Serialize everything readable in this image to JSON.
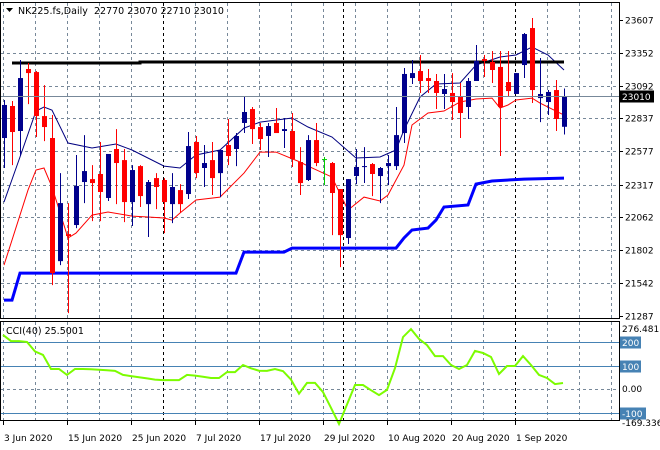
{
  "header": {
    "symbol": "NK225.fs,Daily",
    "ohlc": "22770 23070 22710 23010",
    "menu_icon": "triangle-down-icon"
  },
  "price_axis": {
    "ticks": [
      "23607",
      "23352",
      "23092",
      "22837",
      "22577",
      "22317",
      "22062",
      "21802",
      "21542",
      "21287"
    ],
    "current_price_label": "23010"
  },
  "cci_panel": {
    "title": "CCI(40) 25.5001",
    "max_label": "276.4817",
    "min_label": "-169.336",
    "level_labels": [
      "200",
      "100",
      "-100"
    ],
    "zero_label": "0.00"
  },
  "time_axis": {
    "labels": [
      "3 Jun 2020",
      "15 Jun 2020",
      "25 Jun 2020",
      "7 Jul 2020",
      "17 Jul 2020",
      "29 Jul 2020",
      "10 Aug 2020",
      "20 Aug 2020",
      "1 Sep 2020"
    ]
  },
  "colors": {
    "bull": "#00008c",
    "bear": "#ff0000",
    "doji": "#00d000",
    "ma_fast": "#000080",
    "ma_slow": "#ff0000",
    "support": "#0000ff",
    "resistance": "#000000",
    "cci": "#7cfc00",
    "cci_levels": "#4682b4",
    "grid": "#778899"
  },
  "chart_data": {
    "type": "candlestick",
    "title": "NK225.fs,Daily",
    "ylim": [
      21287,
      23607
    ],
    "current_price": 23010,
    "month_separators": [
      20,
      42.5,
      64
    ],
    "ohlc": [
      [
        22682,
        22980,
        22447,
        22941
      ],
      [
        22933,
        22972,
        22470,
        22729
      ],
      [
        22737,
        23293,
        22541,
        23152
      ],
      [
        23223,
        23270,
        22948,
        23191
      ],
      [
        23199,
        23207,
        22690,
        22854
      ],
      [
        22854,
        23097,
        22658,
        22768
      ],
      [
        22682,
        22862,
        21529,
        21623
      ],
      [
        21717,
        22407,
        21686,
        22172
      ],
      [
        21929,
        22172,
        21310,
        21914
      ],
      [
        22000,
        22549,
        21976,
        22306
      ],
      [
        22337,
        22705,
        22172,
        22423
      ],
      [
        22360,
        22470,
        22031,
        22329
      ],
      [
        22400,
        22651,
        22031,
        22259
      ],
      [
        22212,
        22557,
        22188,
        22557
      ],
      [
        22596,
        22752,
        22164,
        22486
      ],
      [
        22509,
        22596,
        22023,
        22180
      ],
      [
        22180,
        22470,
        21992,
        22431
      ],
      [
        22462,
        22470,
        22141,
        22227
      ],
      [
        22164,
        22353,
        21906,
        22337
      ],
      [
        22368,
        22407,
        22125,
        22298
      ],
      [
        22353,
        22368,
        21937,
        22180
      ],
      [
        22164,
        22407,
        22015,
        22298
      ],
      [
        22274,
        22321,
        22094,
        22164
      ],
      [
        22243,
        22729,
        22204,
        22619
      ],
      [
        22651,
        22698,
        22368,
        22408
      ],
      [
        22447,
        22627,
        22298,
        22486
      ],
      [
        22509,
        22651,
        22235,
        22368
      ],
      [
        22407,
        22588,
        22219,
        22588
      ],
      [
        22627,
        22831,
        22470,
        22541
      ],
      [
        22596,
        22721,
        22462,
        22698
      ],
      [
        22800,
        23003,
        22721,
        22886
      ],
      [
        22909,
        22925,
        22635,
        22752
      ],
      [
        22768,
        22800,
        22588,
        22674
      ],
      [
        22698,
        22800,
        22533,
        22776
      ],
      [
        22800,
        22917,
        22721,
        22721
      ],
      [
        22737,
        22839,
        22604,
        22752
      ],
      [
        22737,
        22878,
        22455,
        22517
      ],
      [
        22494,
        22611,
        22235,
        22329
      ],
      [
        22353,
        22705,
        22345,
        22666
      ],
      [
        22666,
        22800,
        22462,
        22486
      ],
      [
        22517,
        22533,
        22313,
        22517
      ],
      [
        22486,
        22494,
        21921,
        22251
      ],
      [
        22282,
        22282,
        21670,
        21921
      ],
      [
        21898,
        22360,
        21851,
        22360
      ],
      [
        22384,
        22596,
        22321,
        22455
      ],
      [
        22455,
        22611,
        22329,
        22462
      ],
      [
        22478,
        22486,
        22227,
        22400
      ],
      [
        22384,
        22455,
        22172,
        22447
      ],
      [
        22462,
        22549,
        22313,
        22486
      ],
      [
        22462,
        22925,
        22431,
        22705
      ],
      [
        22721,
        23231,
        22643,
        23184
      ],
      [
        23152,
        23293,
        23105,
        23191
      ],
      [
        23207,
        23333,
        23035,
        23129
      ],
      [
        23152,
        23223,
        23035,
        23129
      ],
      [
        23129,
        23184,
        22909,
        23035
      ],
      [
        23027,
        23184,
        22909,
        23066
      ],
      [
        23035,
        23191,
        22823,
        22964
      ],
      [
        23011,
        23113,
        22682,
        22878
      ],
      [
        22925,
        23152,
        22831,
        23129
      ],
      [
        23129,
        23411,
        23129,
        23286
      ],
      [
        23301,
        23333,
        23160,
        23286
      ],
      [
        23278,
        23364,
        23113,
        23215
      ],
      [
        23239,
        23364,
        22541,
        22925
      ],
      [
        23121,
        23364,
        23003,
        23050
      ],
      [
        23027,
        23191,
        23027,
        23191
      ],
      [
        23254,
        23505,
        23152,
        23497
      ],
      [
        23544,
        23623,
        22956,
        23058
      ],
      [
        22995,
        23309,
        22807,
        23027
      ],
      [
        22964,
        23058,
        22862,
        23043
      ],
      [
        23058,
        23137,
        22737,
        22831
      ],
      [
        22770,
        23070,
        22710,
        23010
      ]
    ],
    "ma_fast": [
      [
        0,
        22180
      ],
      [
        2,
        22533
      ],
      [
        4,
        22894
      ],
      [
        5,
        22925
      ],
      [
        6,
        22901
      ],
      [
        8,
        22643
      ],
      [
        11,
        22604
      ],
      [
        14,
        22635
      ],
      [
        16,
        22588
      ],
      [
        20,
        22462
      ],
      [
        22,
        22447
      ],
      [
        24,
        22549
      ],
      [
        27,
        22588
      ],
      [
        30,
        22760
      ],
      [
        32,
        22807
      ],
      [
        36,
        22839
      ],
      [
        38,
        22768
      ],
      [
        41,
        22690
      ],
      [
        44,
        22525
      ],
      [
        47,
        22533
      ],
      [
        49,
        22588
      ],
      [
        50,
        22745
      ],
      [
        52,
        23003
      ],
      [
        54,
        23105
      ],
      [
        57,
        23113
      ],
      [
        59,
        23254
      ],
      [
        62,
        23317
      ],
      [
        64,
        23333
      ],
      [
        66,
        23395
      ],
      [
        68,
        23333
      ],
      [
        70,
        23215
      ]
    ],
    "ma_slow": [
      [
        0,
        21686
      ],
      [
        3,
        22274
      ],
      [
        4,
        22431
      ],
      [
        5,
        22447
      ],
      [
        6,
        22298
      ],
      [
        8,
        21898
      ],
      [
        9,
        21937
      ],
      [
        11,
        22078
      ],
      [
        13,
        22102
      ],
      [
        16,
        22070
      ],
      [
        18,
        22063
      ],
      [
        20,
        22055
      ],
      [
        21,
        22039
      ],
      [
        22,
        22094
      ],
      [
        24,
        22196
      ],
      [
        27,
        22219
      ],
      [
        30,
        22407
      ],
      [
        32,
        22572
      ],
      [
        34,
        22572
      ],
      [
        37,
        22494
      ],
      [
        38,
        22462
      ],
      [
        41,
        22376
      ],
      [
        43,
        22117
      ],
      [
        45,
        22219
      ],
      [
        47,
        22188
      ],
      [
        48,
        22235
      ],
      [
        50,
        22470
      ],
      [
        51,
        22784
      ],
      [
        53,
        22878
      ],
      [
        55,
        22894
      ],
      [
        57,
        22964
      ],
      [
        59,
        22988
      ],
      [
        61,
        22995
      ],
      [
        62,
        22917
      ],
      [
        63,
        22941
      ],
      [
        64,
        22980
      ],
      [
        66,
        22995
      ],
      [
        67,
        22956
      ],
      [
        70,
        22862
      ]
    ],
    "support_line": [
      [
        0,
        21412
      ],
      [
        1,
        21412
      ],
      [
        2,
        21623
      ],
      [
        29,
        21623
      ],
      [
        30,
        21788
      ],
      [
        35,
        21788
      ],
      [
        36,
        21819
      ],
      [
        49,
        21819
      ],
      [
        50,
        21898
      ],
      [
        51,
        21961
      ],
      [
        53,
        21976
      ],
      [
        54,
        22039
      ],
      [
        55,
        22141
      ],
      [
        58,
        22157
      ],
      [
        59,
        22321
      ],
      [
        61,
        22345
      ],
      [
        65,
        22360
      ],
      [
        70,
        22368
      ]
    ],
    "resistance_line": [
      [
        1,
        23270
      ],
      [
        17,
        23270
      ],
      [
        17,
        23278
      ],
      [
        70,
        23278
      ]
    ],
    "cci": {
      "period": 40,
      "ylim": [
        -169.336,
        276.4817
      ],
      "levels": [
        200,
        100,
        0,
        -100
      ],
      "values": [
        230,
        204,
        204,
        200,
        160,
        145,
        85,
        85,
        60,
        85,
        85,
        84,
        82,
        80,
        77,
        60,
        55,
        50,
        45,
        40,
        38,
        38,
        38,
        60,
        57,
        52,
        47,
        47,
        72,
        72,
        102,
        88,
        78,
        77,
        85,
        76,
        40,
        -20,
        26,
        26,
        -13,
        -80,
        -149,
        -66,
        17,
        17,
        -5,
        -26,
        -4,
        89,
        221,
        255,
        213,
        187,
        140,
        140,
        102,
        85,
        102,
        162,
        153,
        136,
        64,
        98,
        98,
        140,
        102,
        60,
        47,
        21,
        25.5
      ]
    }
  }
}
